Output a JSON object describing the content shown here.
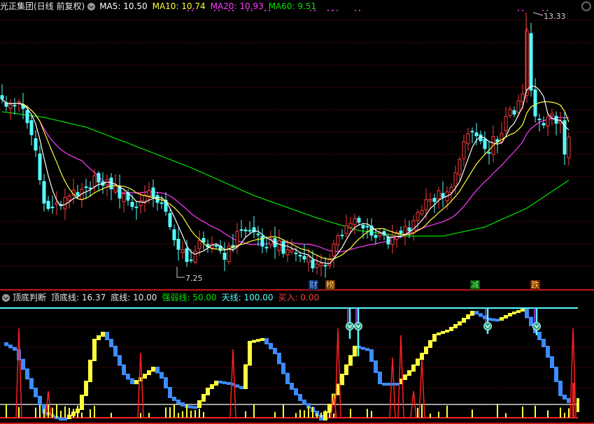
{
  "main_header": {
    "stock_title": "光正集团(日线 前复权)",
    "ma5": "MA5: 10.50",
    "ma10": "MA10: 10.74",
    "ma20": "MA20: 10.93",
    "ma60": "MA60: 9.51"
  },
  "sub_header": {
    "indicator_name": "顶底判断",
    "top_line": "顶底线: 16.37",
    "bottom_line": "底线: 10.00",
    "strength_line": "强弱线: 50.00",
    "sky_line": "天线: 100.00",
    "buy": "买入: 0.00"
  },
  "price_labels": {
    "high": "13.33",
    "low": "7.25"
  },
  "events": {
    "cai": "财",
    "bang": "榜",
    "jian": "减",
    "die": "跌"
  },
  "colors": {
    "up": "#ff3c3c",
    "down": "#54ffff",
    "ma5": "#ffffff",
    "ma10": "#ffff3c",
    "ma20": "#ff3cff",
    "ma60": "#00e600",
    "indicator_up": "#ffff3c",
    "indicator_down": "#3c8cff",
    "sky_line": "#54ffff",
    "grid": "#9a1010"
  },
  "icons": [
    "dropdown-circle-icon",
    "settings-gear-icon",
    "top-signal-arrow-icon"
  ]
}
